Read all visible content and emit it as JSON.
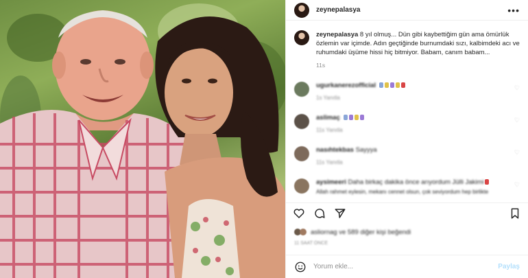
{
  "post": {
    "username": "zeynepalasya",
    "caption_user": "zeynepalasya",
    "caption_text": "8 yıl olmuş... Dün gibi kaybettiğim gün ama ömürlük özlemin var içimde. Adın geçtiğinde burnumdaki sızı, kalbimdeki acı ve ruhumdaki üşüme hissi hiç bitmiyor. Babam, canım babam...",
    "caption_age": "11s",
    "more_icon": "more-horizontal-icon"
  },
  "comments": [
    {
      "user": "ugurkanerezofficial",
      "text": "",
      "meta": "1s   Yanıtla",
      "avatar_color": "#6b7a5e",
      "emojis": [
        "#8aa6d8",
        "#e0c14a",
        "#9b7ad6",
        "#e0c14a",
        "#d94545"
      ]
    },
    {
      "user": "aslimaç",
      "text": "",
      "meta": "11s   Yanıtla",
      "avatar_color": "#5b5148",
      "emojis": [
        "#8aa6d8",
        "#9b7ad6",
        "#e0c14a",
        "#9b7ad6"
      ]
    },
    {
      "user": "nasıhtekbas",
      "text": "Sayyya",
      "meta": "11s   Yanıtla",
      "avatar_color": "#7d6a5b",
      "emojis": []
    },
    {
      "user": "aysimeeri",
      "text": "Daha birkaç dakika önce arıyordum Jülli Jakimi",
      "text2": "Allah rahmet eylesin, mekanı cennet olsun, çok seviyordum hep birlikte",
      "meta": "",
      "avatar_color": "#8a7560",
      "emojis": [
        "#d94545"
      ]
    }
  ],
  "actions": {
    "like_icon": "heart-icon",
    "comment_icon": "comment-icon",
    "share_icon": "send-icon",
    "save_icon": "bookmark-icon"
  },
  "likes": {
    "text": "asliornag ve 589 diğer kişi beğendi"
  },
  "date": "11 SAAT ÖNCE",
  "add_comment": {
    "placeholder": "Yorum ekle...",
    "share_label": "Paylaş",
    "emoji_icon": "smile-icon"
  },
  "colors": {
    "link_disabled": "#b2dffc",
    "meta_gray": "#8e8e8e",
    "border": "#efefef"
  }
}
